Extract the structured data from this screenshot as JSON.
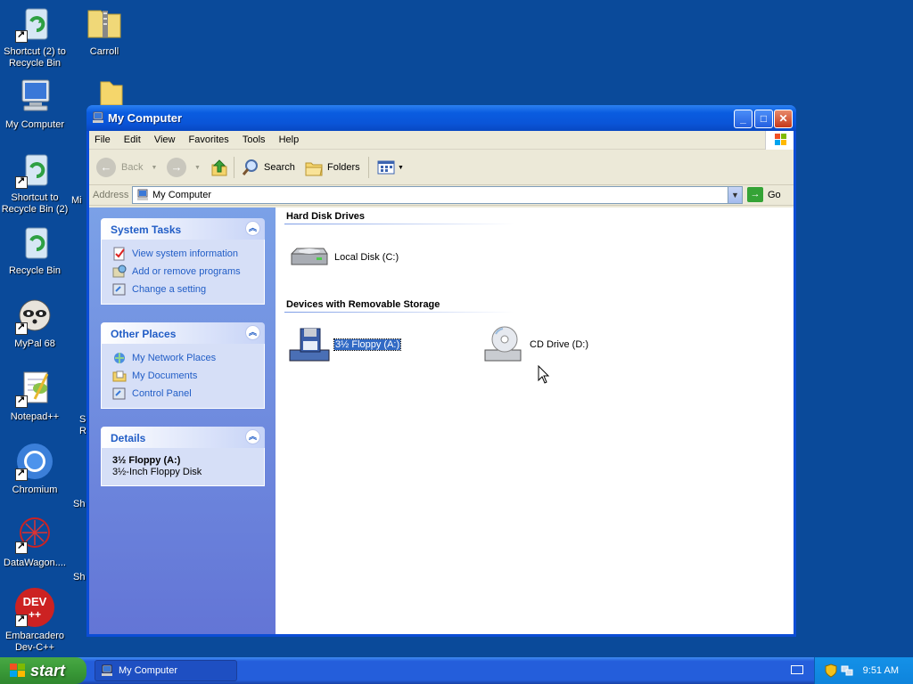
{
  "desktop": {
    "icons": [
      {
        "label": "Shortcut (2) to Recycle Bin",
        "icon": "recycle-bin-icon"
      },
      {
        "label": "Carroll",
        "icon": "zip-folder-icon"
      },
      {
        "label": "My Computer",
        "icon": "computer-icon"
      },
      {
        "label": "Shortcut to Recycle Bin (2)",
        "icon": "recycle-bin-icon"
      },
      {
        "label": "Recycle Bin",
        "icon": "recycle-bin-icon"
      },
      {
        "label": "MyPal 68",
        "icon": "raccoon-icon"
      },
      {
        "label": "Notepad++",
        "icon": "notepad-icon"
      },
      {
        "label": "Chromium",
        "icon": "chromium-icon"
      },
      {
        "label": "DataWagon....",
        "icon": "datawagon-icon"
      },
      {
        "label": "Embarcadero Dev-C++",
        "icon": "devcpp-icon"
      }
    ],
    "partial_labels": [
      "Mi",
      "S",
      "R",
      "Sh",
      "Sh"
    ]
  },
  "window": {
    "title": "My Computer",
    "controls": {
      "minimize": "_",
      "maximize": "□",
      "close": "✕"
    },
    "menu": [
      "File",
      "Edit",
      "View",
      "Favorites",
      "Tools",
      "Help"
    ],
    "toolbar": {
      "back": "Back",
      "search": "Search",
      "folders": "Folders"
    },
    "address": {
      "label": "Address",
      "value": "My Computer",
      "go": "Go"
    },
    "taskpane": {
      "system_tasks": {
        "title": "System Tasks",
        "items": [
          "View system information",
          "Add or remove programs",
          "Change a setting"
        ]
      },
      "other_places": {
        "title": "Other Places",
        "items": [
          "My Network Places",
          "My Documents",
          "Control Panel"
        ]
      },
      "details": {
        "title": "Details",
        "name": "3½ Floppy (A:)",
        "type": "3½-Inch Floppy Disk"
      }
    },
    "content": {
      "hard_disks": {
        "header": "Hard Disk Drives",
        "items": [
          "Local Disk (C:)"
        ]
      },
      "removable": {
        "header": "Devices with Removable Storage",
        "items": [
          "3½ Floppy (A:)",
          "CD Drive (D:)"
        ]
      }
    }
  },
  "taskbar": {
    "start": "start",
    "task": "My Computer",
    "clock": "9:51 AM"
  },
  "colors": {
    "desktop": "#0a4a9a",
    "title_bar": "#0a5ce0",
    "task_link": "#215dc6",
    "selection": "#316ac5",
    "start_green": "#3a9a38"
  }
}
